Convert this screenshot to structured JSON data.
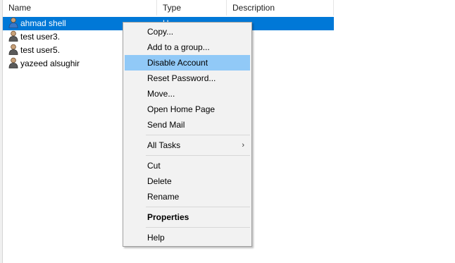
{
  "columns": {
    "name": "Name",
    "type": "Type",
    "description": "Description"
  },
  "rows": [
    {
      "name": "ahmad shell",
      "type": "U",
      "icon": "user-icon",
      "selected": true
    },
    {
      "name": "test user3.",
      "type": "",
      "icon": "user-icon",
      "selected": false
    },
    {
      "name": "test user5.",
      "type": "",
      "icon": "user-icon",
      "selected": false
    },
    {
      "name": "yazeed alsughir",
      "type": "",
      "icon": "user-icon",
      "selected": false
    }
  ],
  "context_menu": {
    "copy": "Copy...",
    "add_to_group": "Add to a group...",
    "disable_account": "Disable Account",
    "reset_password": "Reset Password...",
    "move": "Move...",
    "open_home_page": "Open Home Page",
    "send_mail": "Send Mail",
    "all_tasks": "All Tasks",
    "all_tasks_arrow": "›",
    "cut": "Cut",
    "delete": "Delete",
    "rename": "Rename",
    "properties": "Properties",
    "help": "Help"
  },
  "colors": {
    "selection": "#0078d7",
    "menu_highlight": "#91c9f7",
    "menu_background": "#f2f2f2"
  }
}
